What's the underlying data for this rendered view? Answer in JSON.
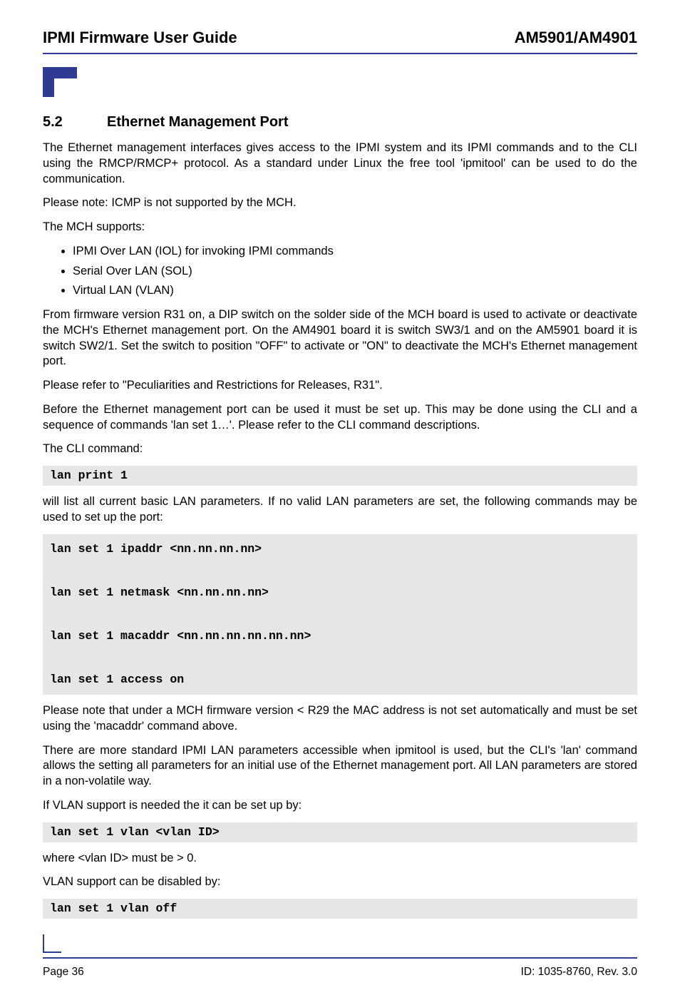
{
  "header": {
    "left": "IPMI Firmware User Guide",
    "right": "AM5901/AM4901"
  },
  "section": {
    "number": "5.2",
    "title": "Ethernet Management Port"
  },
  "paras": {
    "p1": "The Ethernet management interfaces gives access to the IPMI system and its IPMI commands and to the CLI using the RMCP/RMCP+ protocol. As a standard under Linux the free tool 'ipmitool' can be used to do the communication.",
    "p2": "Please note: ICMP is not supported by the MCH.",
    "p3": "The MCH supports:",
    "p4": "From firmware version R31 on, a DIP switch on the solder side of the MCH board is used to activate or deactivate the MCH's Ethernet management port. On the AM4901 board it is switch SW3/1 and on the AM5901 board it is switch SW2/1. Set the switch to position \"OFF\" to activate or  \"ON\" to deactivate the MCH's Ethernet management port.",
    "p5": "Please refer to \"Peculiarities and Restrictions for Releases, R31\".",
    "p6": "Before the Ethernet management port can be used it must be set up. This may be done using the CLI and a sequence of commands 'lan set 1…'. Please refer to the CLI command descriptions.",
    "p7": "The CLI command:",
    "p8": "will list all current basic LAN parameters. If no valid LAN parameters are set, the following commands may be used to set up the port:",
    "p9": "Please note that under a MCH firmware version < R29 the MAC address is not set automatically and must be set using the 'macaddr' command above.",
    "p10": "There are more standard IPMI LAN parameters accessible when ipmitool is used, but the CLI's 'lan' command allows the setting all parameters for an initial use of the Ethernet management port. All LAN parameters are stored in a non-volatile way.",
    "p11": "If VLAN support is needed the it can be set up by:",
    "p12": "where <vlan ID> must be > 0.",
    "p13": "VLAN support can be disabled by:"
  },
  "bullets": {
    "b1": "IPMI Over LAN (IOL) for invoking IPMI commands",
    "b2": "Serial Over LAN (SOL)",
    "b3": "Virtual LAN (VLAN)"
  },
  "code": {
    "c1": "lan print 1",
    "c2": "lan set 1 ipaddr <nn.nn.nn.nn>\n\nlan set 1 netmask <nn.nn.nn.nn>\n\nlan set 1 macaddr <nn.nn.nn.nn.nn.nn>\n\nlan set 1 access on",
    "c3": "lan set 1 vlan <vlan ID>",
    "c4": "lan set 1 vlan off"
  },
  "footer": {
    "page": "Page 36",
    "id": "ID: 1035-8760, Rev. 3.0"
  }
}
